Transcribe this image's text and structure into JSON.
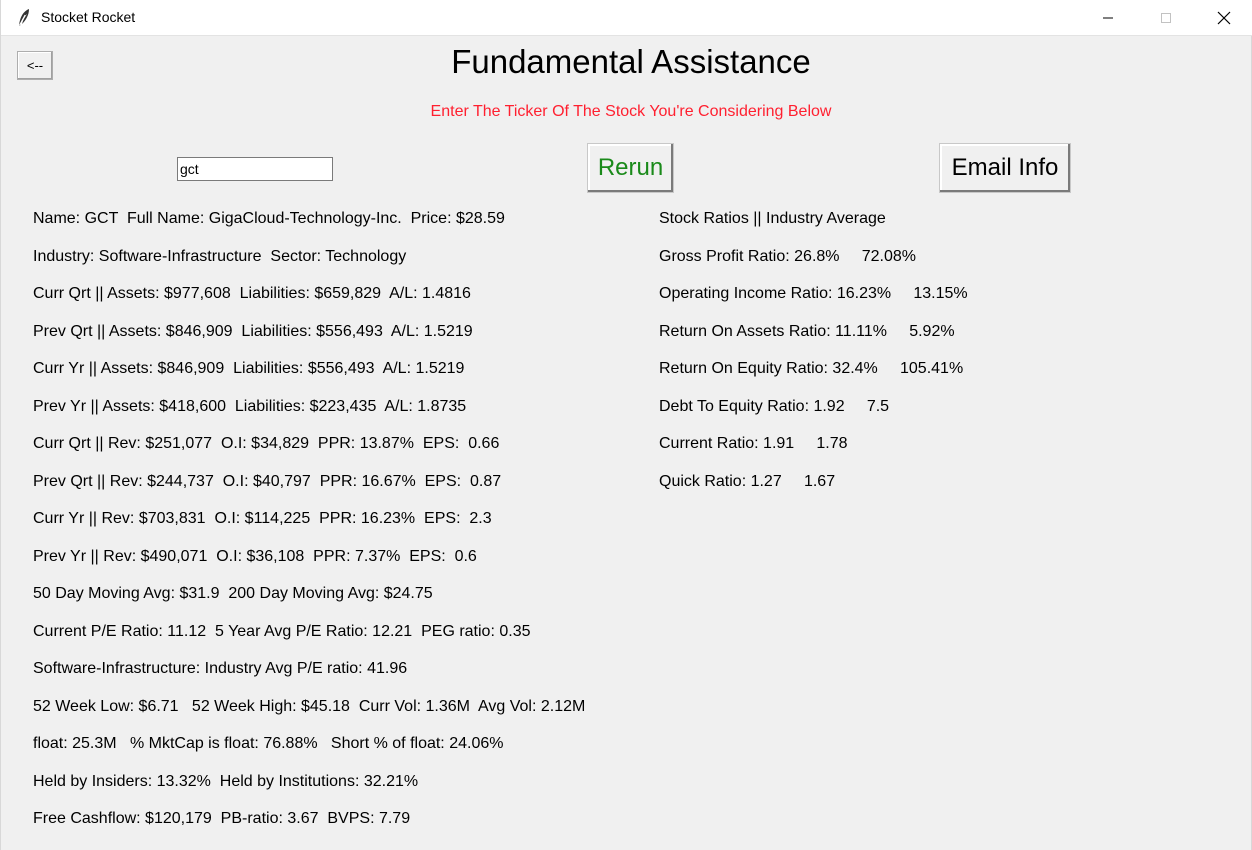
{
  "window": {
    "title": "Stocket Rocket",
    "app_icon": "feather-icon",
    "controls": [
      "minimize-icon",
      "maximize-icon",
      "close-icon"
    ]
  },
  "header": {
    "back_label": "<--",
    "title": "Fundamental Assistance",
    "subtitle": "Enter The Ticker Of The Stock You're Considering Below",
    "subtitle_color": "#ff2030"
  },
  "ticker_input": {
    "value": "gct"
  },
  "buttons": {
    "rerun_label": "Rerun",
    "rerun_color": "#1a8a1a",
    "email_label": "Email Info"
  },
  "left_info": [
    "Name: GCT  Full Name: GigaCloud-Technology-Inc.  Price: $28.59",
    "Industry: Software-Infrastructure  Sector: Technology",
    "Curr Qrt || Assets: $977,608  Liabilities: $659,829  A/L: 1.4816",
    "Prev Qrt || Assets: $846,909  Liabilities: $556,493  A/L: 1.5219",
    "Curr Yr || Assets: $846,909  Liabilities: $556,493  A/L: 1.5219",
    "Prev Yr || Assets: $418,600  Liabilities: $223,435  A/L: 1.8735",
    "Curr Qrt || Rev: $251,077  O.I: $34,829  PPR: 13.87%  EPS:  0.66",
    "Prev Qrt || Rev: $244,737  O.I: $40,797  PPR: 16.67%  EPS:  0.87",
    "Curr Yr || Rev: $703,831  O.I: $114,225  PPR: 16.23%  EPS:  2.3",
    "Prev Yr || Rev: $490,071  O.I: $36,108  PPR: 7.37%  EPS:  0.6",
    "50 Day Moving Avg: $31.9  200 Day Moving Avg: $24.75",
    "Current P/E Ratio: 11.12  5 Year Avg P/E Ratio: 12.21  PEG ratio: 0.35",
    "Software-Infrastructure: Industry Avg P/E ratio: 41.96",
    "52 Week Low: $6.71   52 Week High: $45.18  Curr Vol: 1.36M  Avg Vol: 2.12M",
    "float: 25.3M   % MktCap is float: 76.88%   Short % of float: 24.06%",
    "Held by Insiders: 13.32%  Held by Institutions: 32.21%",
    "Free Cashflow: $120,179  PB-ratio: 3.67  BVPS: 7.79"
  ],
  "right_info": [
    "Stock Ratios || Industry Average",
    "Gross Profit Ratio: 26.8%     72.08%",
    "Operating Income Ratio: 16.23%     13.15%",
    "Return On Assets Ratio: 11.11%     5.92%",
    "Return On Equity Ratio: 32.4%     105.41%",
    "Debt To Equity Ratio: 1.92     7.5",
    "Current Ratio: 1.91     1.78",
    "Quick Ratio: 1.27     1.67"
  ]
}
